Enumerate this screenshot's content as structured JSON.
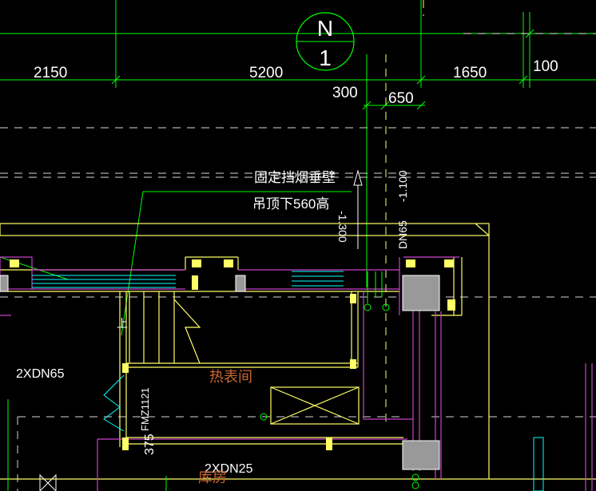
{
  "north_arrow": {
    "letter": "N",
    "number": "1"
  },
  "dimensions": {
    "d1": "2150",
    "d2": "5200",
    "d3": "1650",
    "d4": "100",
    "d5": "300",
    "d6": "650"
  },
  "notes": {
    "smoke_wall_line1": "固定挡烟垂壁",
    "smoke_wall_line2": "吊顶下560高"
  },
  "pipes": {
    "dn65_vertical": "DN65",
    "elev_vertical": "-1.100",
    "elev_left": "-1.300",
    "dn65_left": "2XDN65",
    "dn25_bottom": "2XDN25"
  },
  "rooms": {
    "heat_meter_room": "热表间",
    "storage_room": "库房"
  },
  "doors": {
    "door_code": "FMZ1121",
    "door_dim": "375"
  },
  "colors": {
    "background": "#000000",
    "grid": "#00ff00",
    "wall": "#ffff66",
    "partition": "#cc44cc",
    "pipe": "#00ffff",
    "text": "#ffffff",
    "room_label": "#cc6633"
  }
}
